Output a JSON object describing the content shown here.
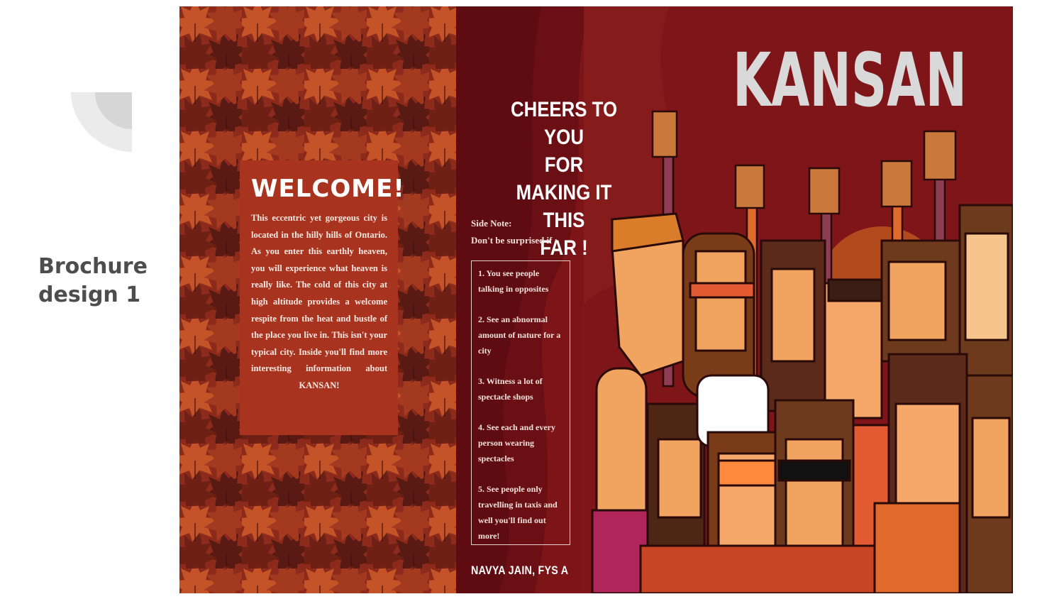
{
  "slide": {
    "title": "Brochure design 1"
  },
  "brochure": {
    "welcome": {
      "title": "WELCOME!",
      "text": "This eccentric yet gorgeous city is located in the hilly hills of Ontario. As you enter this earthly heaven, you will experience what heaven is really like. The cold of this city at high altitude provides a welcome respite from the heat and bustle of the place you live in. This isn't your typical city. Inside you'll find more interesting information about KANSAN!"
    },
    "cheers": {
      "line1": "CHEERS TO YOU",
      "line2": "FOR",
      "line3": "MAKING IT THIS",
      "line4": "FAR !"
    },
    "side_note": {
      "label": "Side Note:",
      "intro": "Don't be surprised if :"
    },
    "list": [
      "1. You see people talking in opposites",
      "2. See an abnormal amount of nature for a city",
      "3. Witness a lot of spectacle shops",
      "4. See each and every person wearing spectacles",
      "5. See people only travelling in taxis and well you'll find out more!"
    ],
    "author": "NAVYA JAIN, FYS A",
    "logo_text": "KANSAN"
  },
  "colors": {
    "deep_red": "#7a1216",
    "rust": "#a8341f",
    "leaf_dark": "#5a1a14",
    "leaf_orange": "#c2522a",
    "logo_grey": "#d9d9d9"
  }
}
